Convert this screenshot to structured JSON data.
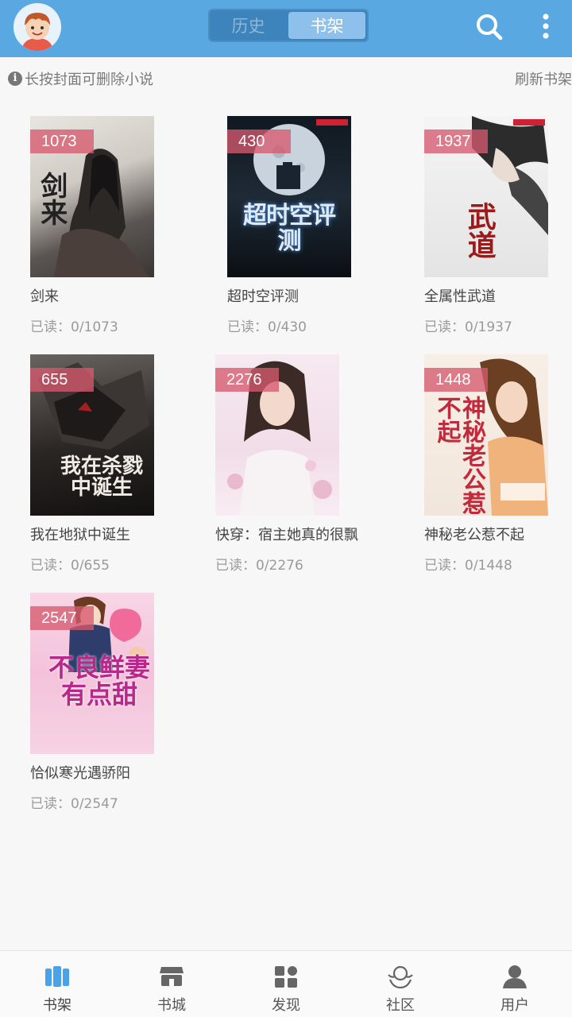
{
  "header": {
    "tabs": [
      {
        "label": "历史",
        "active": false
      },
      {
        "label": "书架",
        "active": true
      }
    ],
    "accent_color": "#5aa8e2"
  },
  "tipbar": {
    "tip": "长按封面可删除小说",
    "refresh": "刷新书架"
  },
  "books": [
    {
      "title": "剑来",
      "count": "1073",
      "progress": "已读：0/1073",
      "cover_text": "剑来"
    },
    {
      "title": "超时空评测",
      "count": "430",
      "progress": "已读：0/430",
      "cover_text": "超时空评测"
    },
    {
      "title": "全属性武道",
      "count": "1937",
      "progress": "已读：0/1937",
      "cover_text": "武道"
    },
    {
      "title": "我在地狱中诞生",
      "count": "655",
      "progress": "已读：0/655",
      "cover_text": "我在杀戮中诞生"
    },
    {
      "title": "快穿：宿主她真的很飘",
      "count": "2276",
      "progress": "已读：0/2276",
      "cover_text": ""
    },
    {
      "title": "神秘老公惹不起",
      "count": "1448",
      "progress": "已读：0/1448",
      "cover_text": "神秘老公惹不起"
    },
    {
      "title": "恰似寒光遇骄阳",
      "count": "2547",
      "progress": "已读：0/2547",
      "cover_text": "不良鲜妻有点甜"
    }
  ],
  "bottom_nav": [
    {
      "label": "书架",
      "icon": "bookshelf-icon",
      "active": true
    },
    {
      "label": "书城",
      "icon": "store-icon",
      "active": false
    },
    {
      "label": "发现",
      "icon": "discover-icon",
      "active": false
    },
    {
      "label": "社区",
      "icon": "community-icon",
      "active": false
    },
    {
      "label": "用户",
      "icon": "user-icon",
      "active": false
    }
  ]
}
